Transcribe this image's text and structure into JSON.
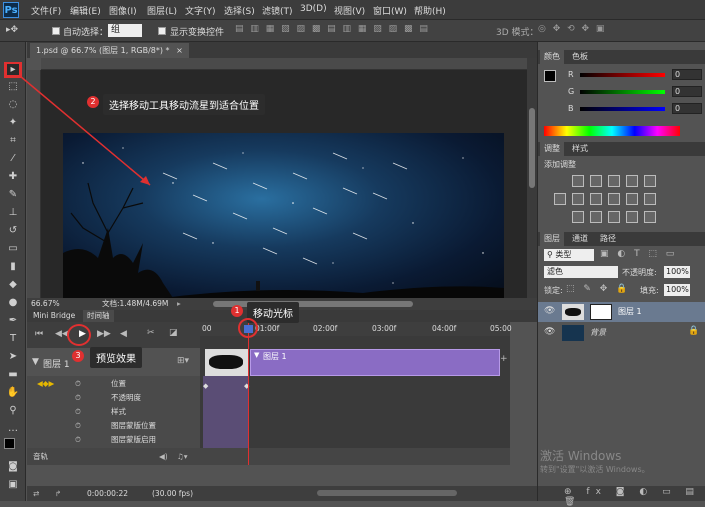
{
  "app": {
    "logo": "Ps"
  },
  "menu": [
    "文件(F)",
    "编辑(E)",
    "图像(I)",
    "图层(L)",
    "文字(Y)",
    "选择(S)",
    "滤镜(T)",
    "3D(D)",
    "视图(V)",
    "窗口(W)",
    "帮助(H)"
  ],
  "options": {
    "auto_select_label": "自动选择：",
    "auto_select_value": "组",
    "show_transform_label": "显示变换控件",
    "mode_3d_label": "3D 模式："
  },
  "document": {
    "tab_title": "1.psd @ 66.7% (图层 1, RGB/8*) *",
    "zoom": "66.67%",
    "doc_info": "文档:1.48M/4.69M"
  },
  "callouts": {
    "move_tool": {
      "num": "2",
      "text": "选择移动工具移动流星到适合位置"
    },
    "move_cursor": {
      "num": "1",
      "text": "移动光标"
    },
    "preview": {
      "num": "3",
      "text": "预览效果"
    }
  },
  "timeline": {
    "tabs": [
      "Mini Bridge",
      "时间轴"
    ],
    "ruler": [
      "00",
      "01:00f",
      "02:00f",
      "03:00f",
      "04:00f",
      "05:00"
    ],
    "layer_name": "图层 1",
    "clip_label": "图层 1",
    "properties": [
      "位置",
      "不透明度",
      "样式",
      "图层蒙版位置",
      "图层蒙版启用"
    ],
    "audio_label": "音轨",
    "timecode": "0:00:00:22",
    "fps": "(30.00 fps)"
  },
  "right": {
    "color_tabs": [
      "颜色",
      "色板"
    ],
    "rgb": [
      {
        "ch": "R",
        "val": "0"
      },
      {
        "ch": "G",
        "val": "0"
      },
      {
        "ch": "B",
        "val": "0"
      }
    ],
    "adjust_tabs": [
      "调整",
      "样式"
    ],
    "add_adjustment": "添加调整",
    "layers_tabs": [
      "图层",
      "通道",
      "路径"
    ],
    "kind_label": "类型",
    "blend_mode": "滤色",
    "opacity_label": "不透明度:",
    "opacity_value": "100%",
    "lock_label": "锁定:",
    "fill_label": "填充:",
    "fill_value": "100%",
    "layers": [
      {
        "name": "图层 1"
      },
      {
        "name": "背景"
      }
    ],
    "watermark1": "激活 Windows",
    "watermark2": "转到\"设置\"以激活 Windows。"
  },
  "colors": {
    "accent_red": "#e03030",
    "clip_purple": "#8a6cc4"
  }
}
